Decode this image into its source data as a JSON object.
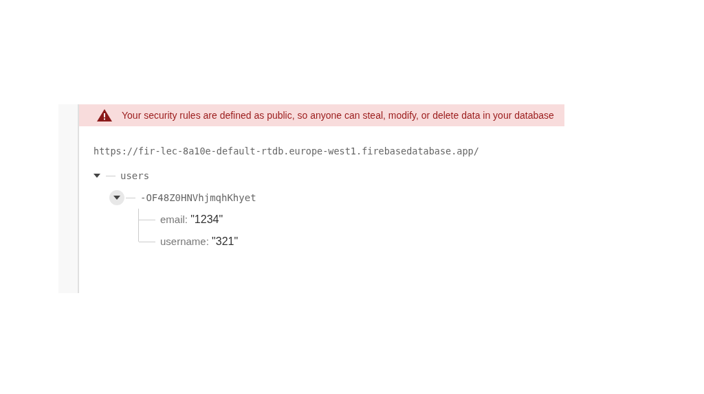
{
  "banner": {
    "text": "Your security rules are defined as public, so anyone can steal, modify, or delete data in your database"
  },
  "database_url": "https://fir-lec-8a10e-default-rtdb.europe-west1.firebasedatabase.app/",
  "tree": [
    {
      "key": "users",
      "expanded": true,
      "focused": false,
      "children": [
        {
          "key": "-OF48Z0HNVhjmqhKhyet",
          "expanded": true,
          "focused": true,
          "children": [
            {
              "key": "email:",
              "value": "\"1234\""
            },
            {
              "key": "username:",
              "value": "\"321\""
            }
          ]
        }
      ]
    }
  ]
}
